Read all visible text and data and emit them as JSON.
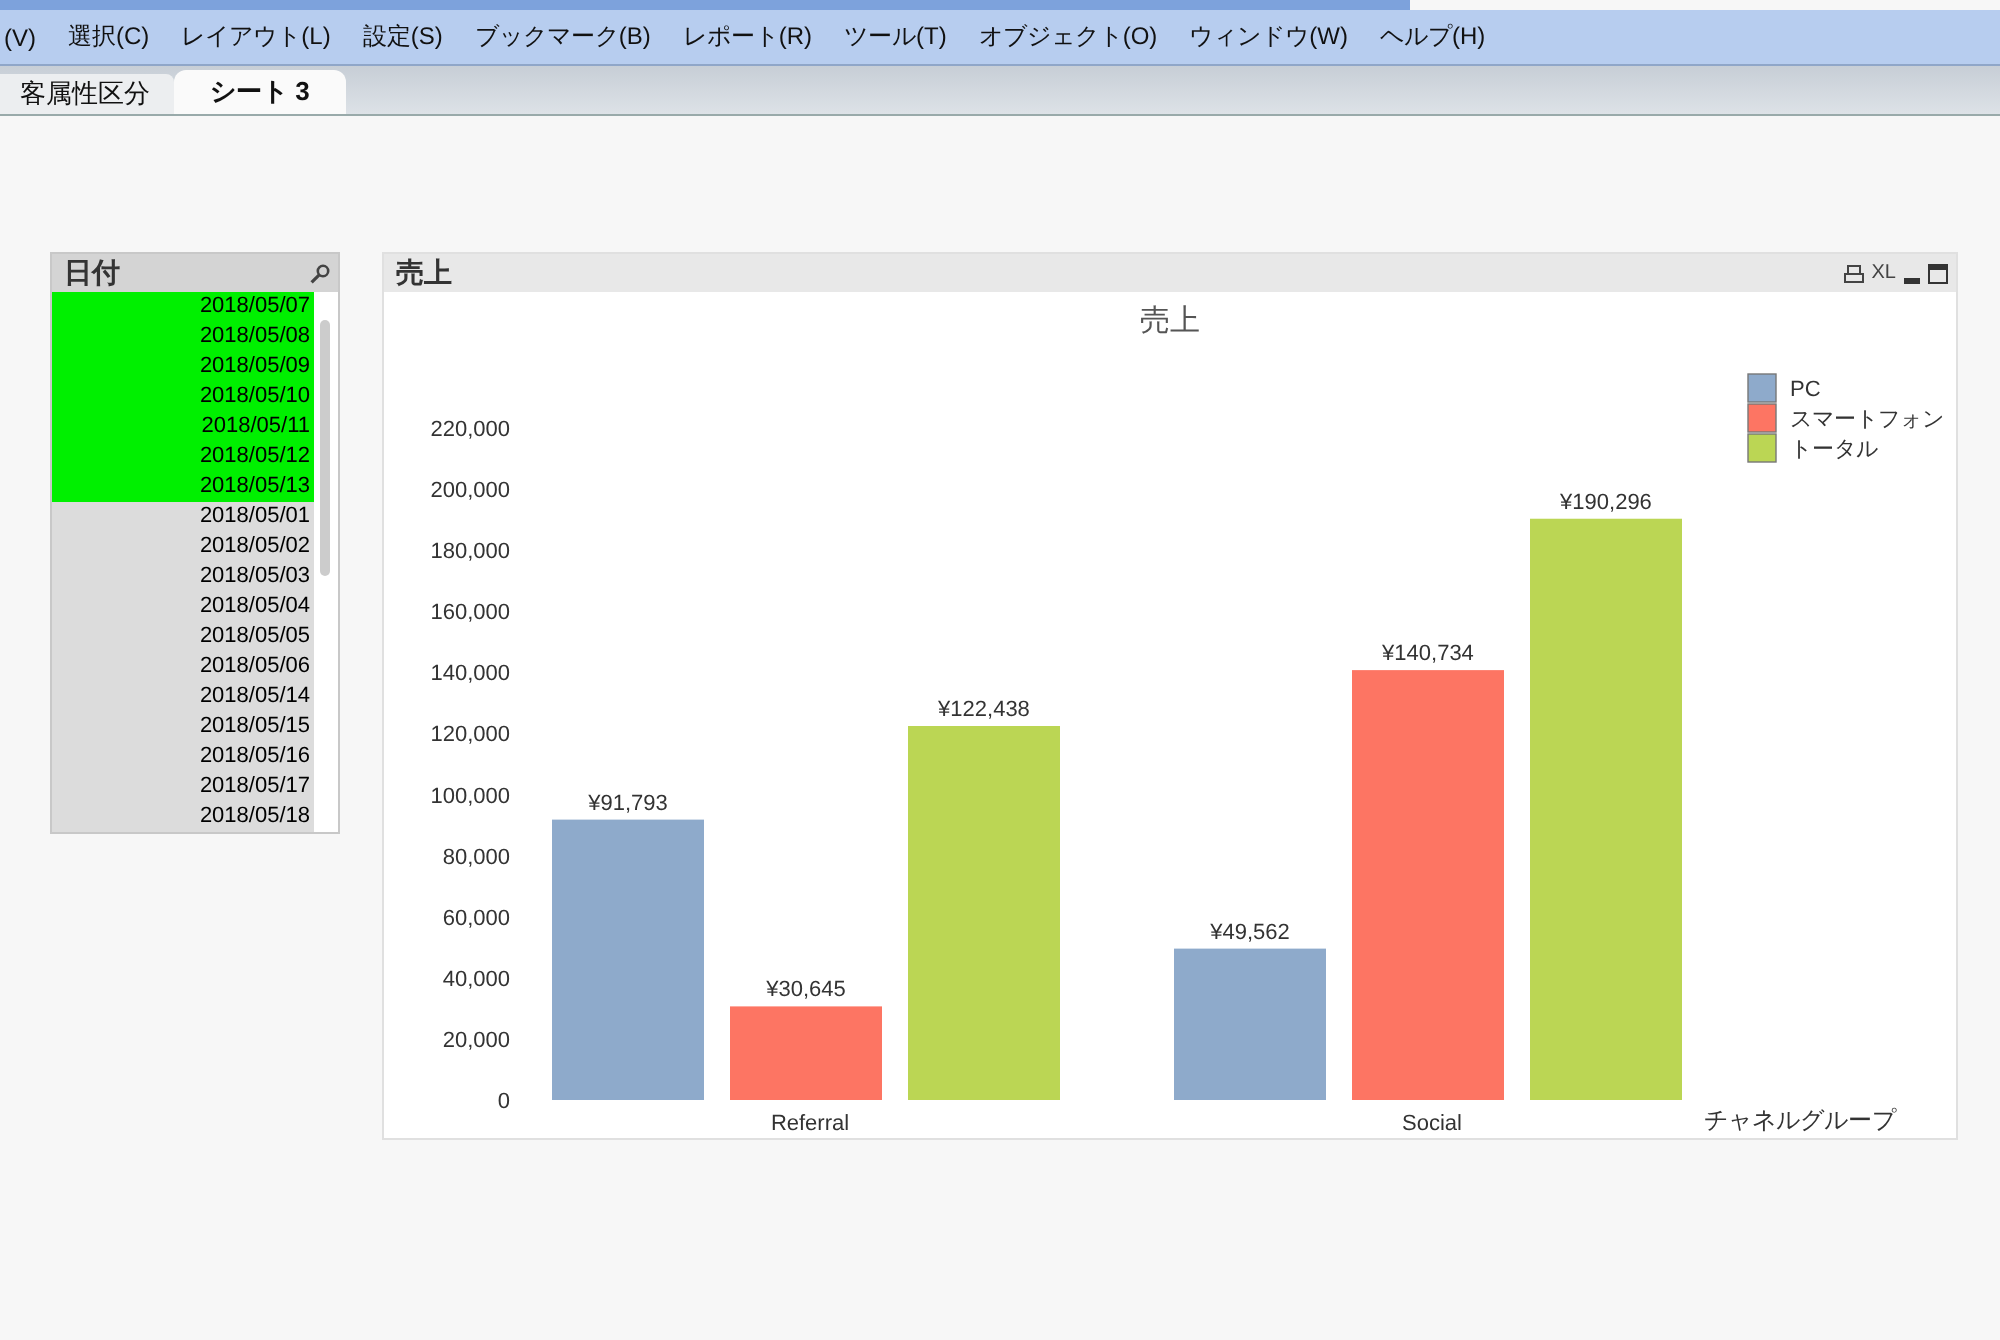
{
  "menu": [
    "(V)",
    "選択(C)",
    "レイアウト(L)",
    "設定(S)",
    "ブックマーク(B)",
    "レポート(R)",
    "ツール(T)",
    "オブジェクト(O)",
    "ウィンドウ(W)",
    "ヘルプ(H)"
  ],
  "tabs": [
    {
      "label": "客属性区分",
      "selected": false
    },
    {
      "label": "シート 3",
      "selected": true
    }
  ],
  "listbox": {
    "title": "日付",
    "items": [
      {
        "label": "2018/05/07",
        "selected": true
      },
      {
        "label": "2018/05/08",
        "selected": true
      },
      {
        "label": "2018/05/09",
        "selected": true
      },
      {
        "label": "2018/05/10",
        "selected": true
      },
      {
        "label": "2018/05/11",
        "selected": true
      },
      {
        "label": "2018/05/12",
        "selected": true
      },
      {
        "label": "2018/05/13",
        "selected": true
      },
      {
        "label": "2018/05/01",
        "selected": false
      },
      {
        "label": "2018/05/02",
        "selected": false
      },
      {
        "label": "2018/05/03",
        "selected": false
      },
      {
        "label": "2018/05/04",
        "selected": false
      },
      {
        "label": "2018/05/05",
        "selected": false
      },
      {
        "label": "2018/05/06",
        "selected": false
      },
      {
        "label": "2018/05/14",
        "selected": false
      },
      {
        "label": "2018/05/15",
        "selected": false
      },
      {
        "label": "2018/05/16",
        "selected": false
      },
      {
        "label": "2018/05/17",
        "selected": false
      },
      {
        "label": "2018/05/18",
        "selected": false
      }
    ]
  },
  "chart_panel": {
    "title": "売上",
    "xl_button": "XL",
    "chart_data": {
      "type": "bar",
      "title": "売上",
      "xlabel": "チャネルグループ",
      "categories": [
        "Referral",
        "Social"
      ],
      "series": [
        {
          "name": "PC",
          "color": "#8eaacb",
          "values": [
            91793,
            49562
          ]
        },
        {
          "name": "スマートフォン",
          "color": "#fd7563",
          "values": [
            30645,
            140734
          ]
        },
        {
          "name": "トータル",
          "color": "#bbd654",
          "values": [
            122438,
            190296
          ]
        }
      ],
      "legend": true,
      "ylim": [
        0,
        220000
      ],
      "yticks": [
        {
          "value": 0,
          "label": "0"
        },
        {
          "value": 20000,
          "label": "20,000"
        },
        {
          "value": 40000,
          "label": "40,000"
        },
        {
          "value": 60000,
          "label": "60,000"
        },
        {
          "value": 80000,
          "label": "80,000"
        },
        {
          "value": 100000,
          "label": "100,000"
        },
        {
          "value": 120000,
          "label": "120,000"
        },
        {
          "value": 140000,
          "label": "140,000"
        },
        {
          "value": 160000,
          "label": "160,000"
        },
        {
          "value": 180000,
          "label": "180,000"
        },
        {
          "value": 200000,
          "label": "200,000"
        },
        {
          "value": 220000,
          "label": "220,000"
        }
      ],
      "value_labels": [
        [
          "¥91,793",
          "¥49,562"
        ],
        [
          "¥30,645",
          "¥140,734"
        ],
        [
          "¥122,438",
          "¥190,296"
        ]
      ]
    }
  }
}
